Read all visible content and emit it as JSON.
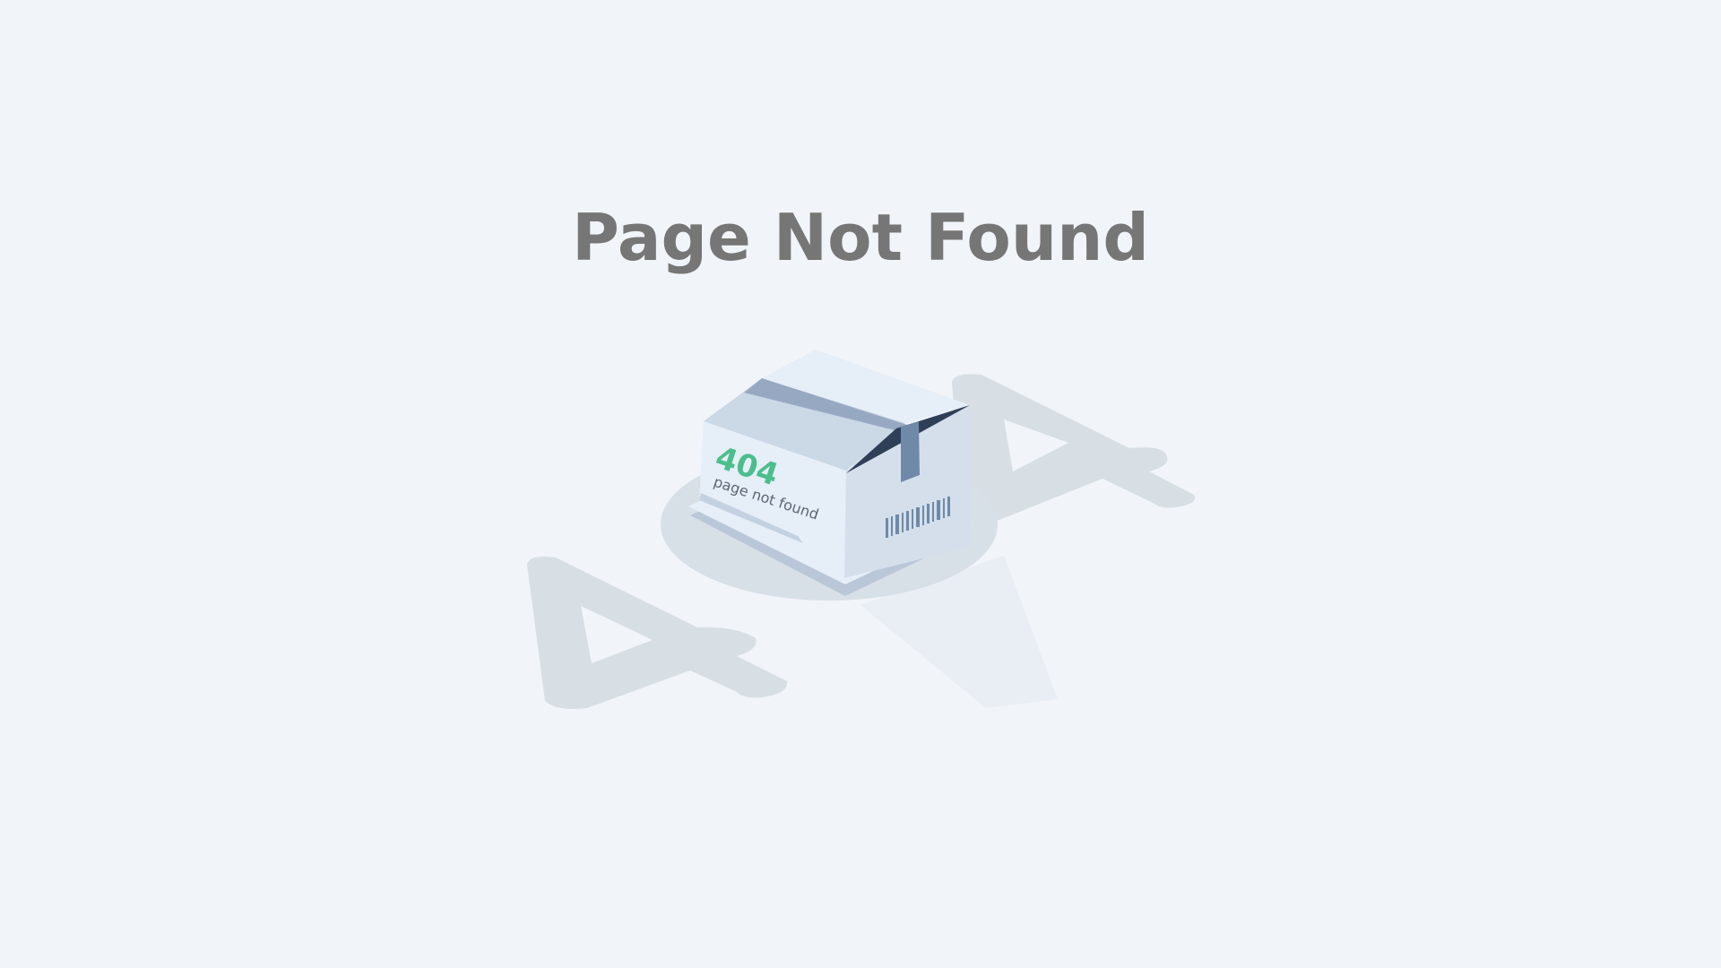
{
  "page": {
    "title": "Page Not Found"
  },
  "illustration": {
    "box_code": "404",
    "box_text": "page not found",
    "shadow_left_glyph": "4",
    "shadow_right_glyph": "4"
  },
  "colors": {
    "background": "#f1f4f9",
    "title": "#767676",
    "accent_green": "#4cbe8c",
    "box_light": "#e6eef8",
    "box_mid": "#cfdbe8",
    "box_dark": "#2f3f57",
    "shadow": "#d8e0e7"
  },
  "icons": {
    "box": "open-box-illustration-icon",
    "barcode": "barcode-icon"
  }
}
